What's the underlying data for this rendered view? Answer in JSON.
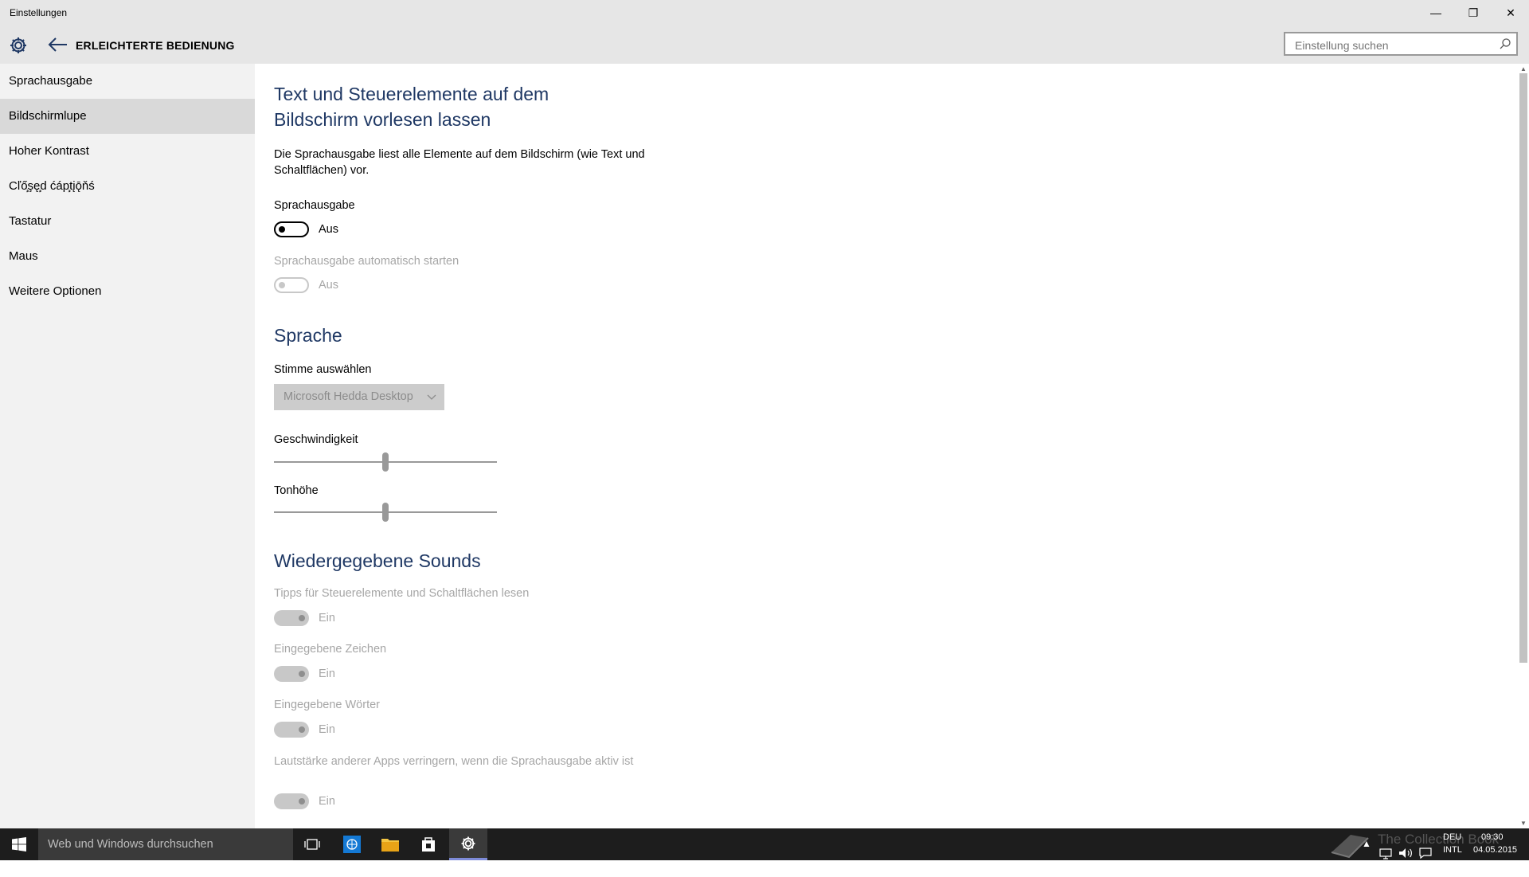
{
  "window": {
    "title": "Einstellungen",
    "minimize_glyph": "—",
    "restore_glyph": "❐",
    "close_glyph": "✕"
  },
  "header": {
    "title": "ERLEICHTERTE BEDIENUNG",
    "search_placeholder": "Einstellung suchen"
  },
  "sidebar": {
    "active_index": 1,
    "items": [
      {
        "label": "Sprachausgabe"
      },
      {
        "label": "Bildschirmlupe"
      },
      {
        "label": "Hoher Kontrast"
      },
      {
        "label": "Cľő̧şę̧d ćáp̧tįǭňś"
      },
      {
        "label": "Tastatur"
      },
      {
        "label": "Maus"
      },
      {
        "label": "Weitere Optionen"
      }
    ]
  },
  "main": {
    "heading": "Text und Steuerelemente auf dem Bildschirm vorlesen lassen",
    "description": "Die Sprachausgabe liest alle Elemente auf dem Bildschirm (wie Text und Schaltflächen) vor.",
    "narrator": {
      "label": "Sprachausgabe",
      "state": "Aus",
      "on": false
    },
    "autostart": {
      "label": "Sprachausgabe automatisch starten",
      "state": "Aus",
      "on": false,
      "disabled": true
    },
    "language": {
      "heading": "Sprache",
      "voice_label": "Stimme auswählen",
      "voice_value": "Microsoft Hedda Desktop",
      "speed_label": "Geschwindigkeit",
      "speed_value": 0.5,
      "pitch_label": "Tonhöhe",
      "pitch_value": 0.5
    },
    "sounds": {
      "heading": "Wiedergegebene Sounds",
      "items": [
        {
          "label": "Tipps für Steuerelemente und Schaltflächen lesen",
          "state": "Ein",
          "on": true,
          "disabled": true
        },
        {
          "label": "Eingegebene Zeichen",
          "state": "Ein",
          "on": true,
          "disabled": true
        },
        {
          "label": "Eingegebene Wörter",
          "state": "Ein",
          "on": true,
          "disabled": true
        },
        {
          "label": "Lautstärke anderer Apps verringern, wenn die Sprachausgabe aktiv ist",
          "state": "Ein",
          "on": true,
          "disabled": true
        }
      ]
    }
  },
  "taskbar": {
    "search_placeholder": "Web und Windows durchsuchen",
    "lang_top": "DEU",
    "lang_bottom": "INTL",
    "time": "09:30",
    "date": "04.05.2015",
    "watermark": "The Collection Book"
  },
  "colors": {
    "chrome": "#e6e6e6",
    "sidebar": "#f2f2f2",
    "sidebar_active": "#d9d9d9",
    "heading": "#1f3864",
    "taskbar": "#1d1d1d",
    "accent": "#7e8bd8"
  }
}
